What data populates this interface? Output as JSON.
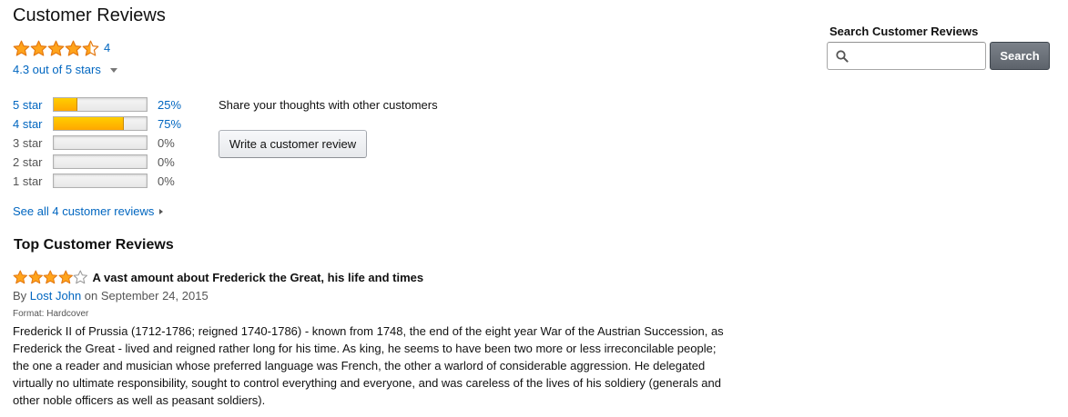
{
  "colors": {
    "link": "#0066c0",
    "star_fill": "#ffa41c",
    "star_stroke": "#e47911",
    "bar_fill": "#ffa700",
    "search_button": "#5d636b"
  },
  "header": {
    "title": "Customer Reviews"
  },
  "summary": {
    "rating": 4.3,
    "rating_count": "4",
    "rating_text": "4.3 out of 5 stars",
    "icon": "chevron-down-icon"
  },
  "histogram": [
    {
      "label": "5 star",
      "percent_text": "25%",
      "fill_fraction": 0.25,
      "linked": true
    },
    {
      "label": "4 star",
      "percent_text": "75%",
      "fill_fraction": 0.75,
      "linked": true
    },
    {
      "label": "3 star",
      "percent_text": "0%",
      "fill_fraction": 0,
      "linked": false
    },
    {
      "label": "2 star",
      "percent_text": "0%",
      "fill_fraction": 0,
      "linked": false
    },
    {
      "label": "1 star",
      "percent_text": "0%",
      "fill_fraction": 0,
      "linked": false
    }
  ],
  "share": {
    "text": "Share your thoughts with other customers",
    "button_label": "Write a customer review"
  },
  "see_all": {
    "text": "See all 4 customer reviews",
    "icon": "chevron-right-icon"
  },
  "top_reviews": {
    "heading": "Top Customer Reviews",
    "items": [
      {
        "rating": 4,
        "title": "A vast amount about Frederick the Great, his life and times",
        "by_prefix": "By",
        "author": "Lost John",
        "date_text": "on September 24, 2015",
        "format": "Format: Hardcover",
        "body_lines": [
          "Frederick II of Prussia (1712-1786; reigned 1740-1786) - known from 1748, the end of the eight year War of the Austrian Succession, as",
          "Frederick the Great - lived and reigned rather long for his time. As king, he seems to have been two more or less irreconcilable people;",
          "the one a reader and musician whose preferred language was French, the other a warlord of considerable aggression. He delegated",
          "virtually no ultimate responsibility, sought to control everything and everyone, and was careless of the lives of his soldiery (generals and",
          "other noble officers as well as peasant soldiers)."
        ]
      }
    ]
  },
  "search": {
    "heading": "Search Customer Reviews",
    "input_value": "",
    "placeholder": "",
    "button_label": "Search",
    "icon": "search-icon"
  }
}
